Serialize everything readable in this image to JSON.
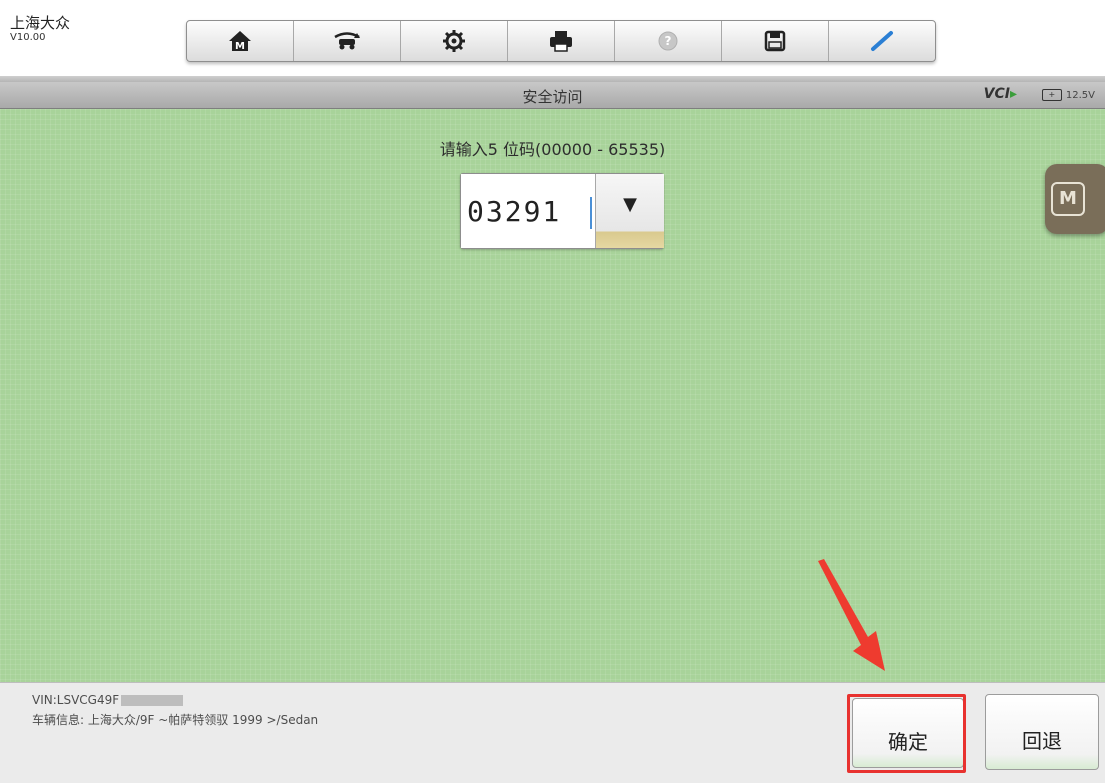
{
  "app": {
    "brand": "上海大众",
    "version": "V10.00"
  },
  "toolbar": {
    "buttons": [
      {
        "icon": "home-icon"
      },
      {
        "icon": "vehicle-swap-icon"
      },
      {
        "icon": "settings-gear-icon"
      },
      {
        "icon": "printer-icon"
      },
      {
        "icon": "help-icon"
      },
      {
        "icon": "save-icon"
      },
      {
        "icon": "pen-icon"
      }
    ]
  },
  "titlebar": {
    "title": "安全访问",
    "vci_text": "VCI",
    "battery_icon_text": "+",
    "battery_voltage": "12.5V"
  },
  "main": {
    "prompt": "请输入5 位码(00000 - 65535)",
    "code_value": "03291",
    "dropdown_arrow": "▼",
    "m_button_label": "M"
  },
  "footer": {
    "vin_label": "VIN:LSVCG49F",
    "vehicle_info": "车辆信息: 上海大众/9F ~帕萨特领驭 1999 >/Sedan",
    "ok_label": "确定",
    "back_label": "回退"
  },
  "colors": {
    "content_bg": "#a8d39a",
    "highlight_red": "#e8322f",
    "arrow_red": "#ee3b2f",
    "m_button_bg": "#7a6e59"
  }
}
